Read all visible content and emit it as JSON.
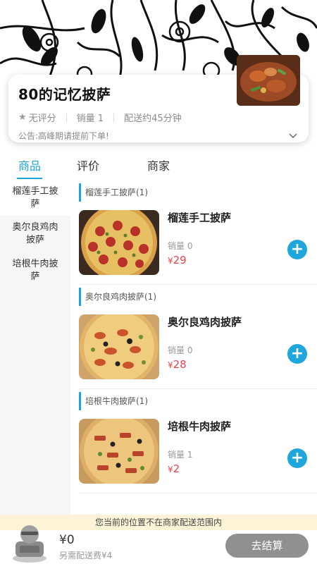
{
  "shop": {
    "name": "80的记忆披萨",
    "rating": "无评分",
    "sales": "销量 1",
    "delivery": "配送约45分钟",
    "notice": "公告:高峰期请提前下单!"
  },
  "tabs": [
    {
      "label": "商品",
      "active": true
    },
    {
      "label": "评价",
      "active": false
    },
    {
      "label": "商家",
      "active": false
    }
  ],
  "sidebar": {
    "items": [
      {
        "label": "榴莲手工披萨",
        "active": true
      },
      {
        "label": "奥尔良鸡肉披萨",
        "active": false
      },
      {
        "label": "培根牛肉披萨",
        "active": false
      }
    ]
  },
  "sections": [
    {
      "title": "榴莲手工披萨(1)",
      "item": {
        "name": "榴莲手工披萨",
        "sales": "销量 0",
        "currency": "¥",
        "price": "29",
        "image": "pepperoni-pizza"
      }
    },
    {
      "title": "奥尔良鸡肉披萨(1)",
      "item": {
        "name": "奥尔良鸡肉披萨",
        "sales": "销量 0",
        "currency": "¥",
        "price": "28",
        "image": "chicken-pizza"
      }
    },
    {
      "title": "培根牛肉披萨(1)",
      "item": {
        "name": "培根牛肉披萨",
        "sales": "销量 1",
        "currency": "¥",
        "price": "2",
        "image": "bacon-beef-pizza"
      }
    }
  ],
  "range_notice": "您当前的位置不在商家配送范围内",
  "cart": {
    "total": "¥0",
    "extra_fee": "另需配送费¥4",
    "checkout_label": "去结算"
  },
  "colors": {
    "accent": "#1ea5d8",
    "price": "#e2454a",
    "checkout_disabled": "#909090",
    "notice_bg": "#fdf4d7"
  }
}
